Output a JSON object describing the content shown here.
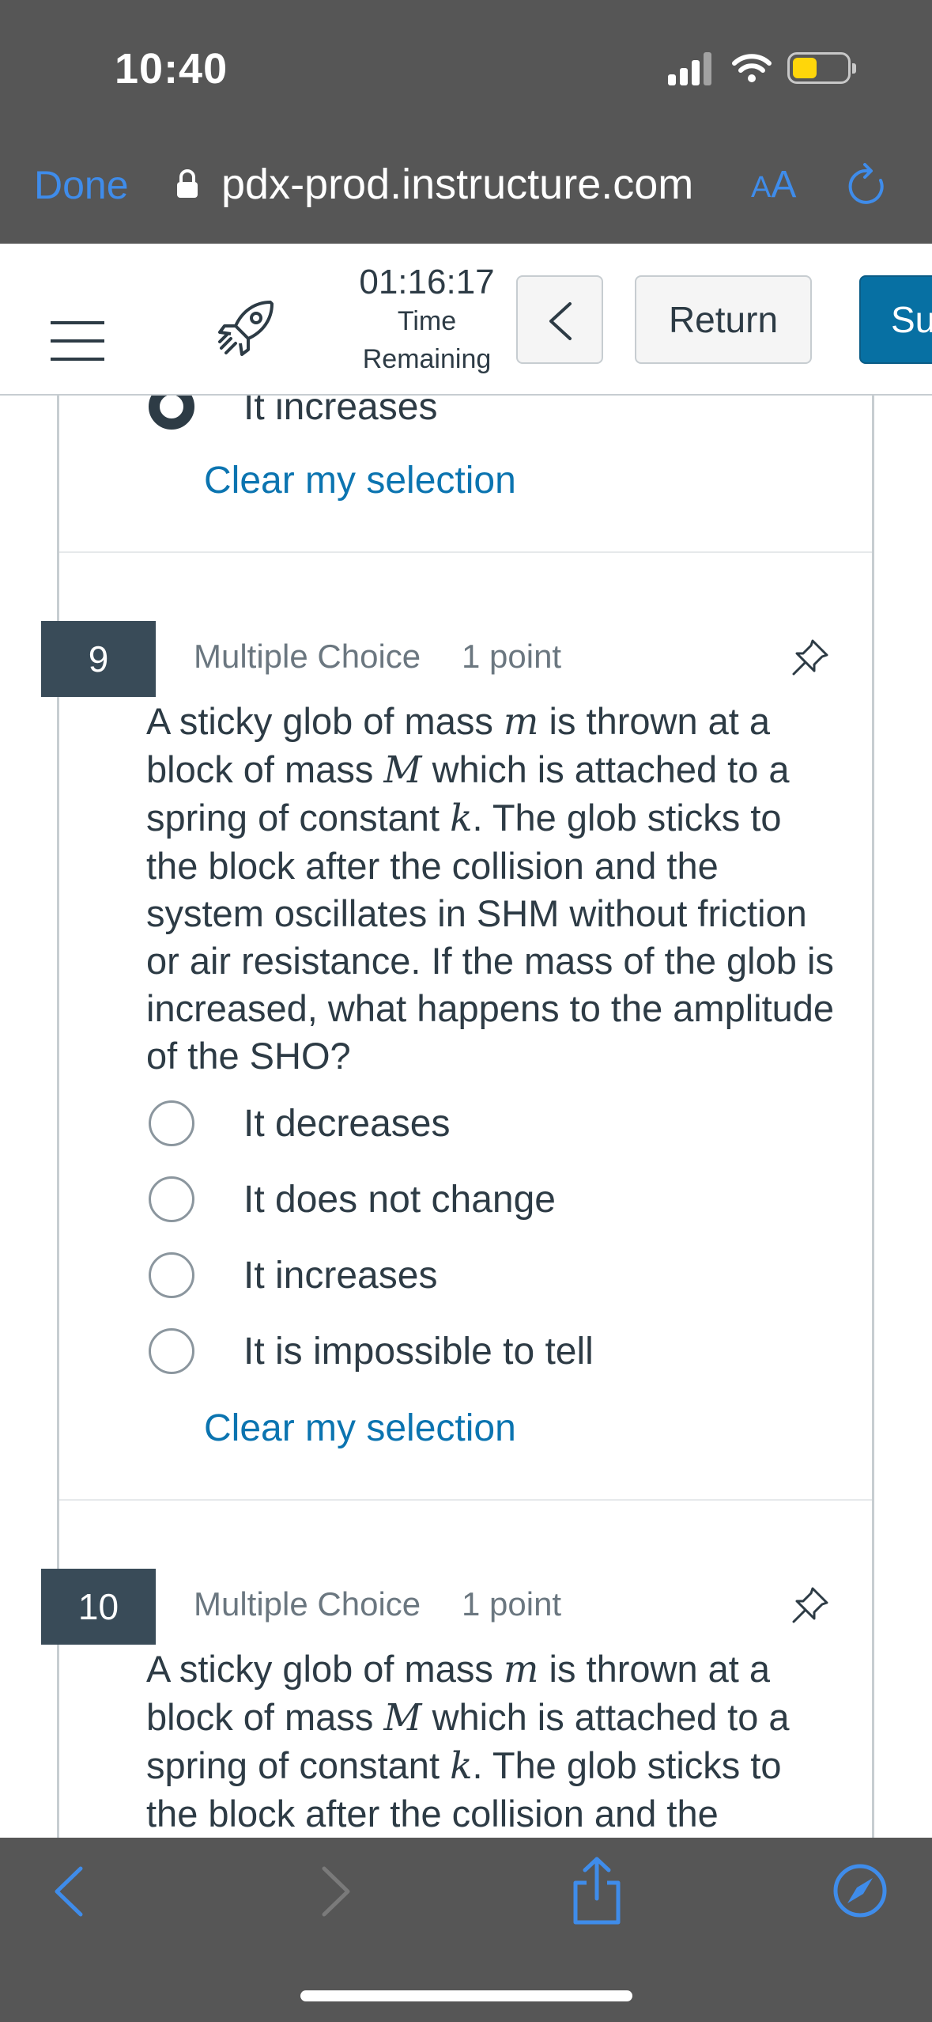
{
  "status_bar": {
    "time": "10:40"
  },
  "browser": {
    "done_label": "Done",
    "url": "pdx-prod.instructure.com",
    "text_size_label_small": "A",
    "text_size_label_large": "A",
    "accent_color": "#3f8cea"
  },
  "quiz_header": {
    "timer_value": "01:16:17",
    "timer_label_line1": "Time",
    "timer_label_line2": "Remaining",
    "return_label": "Return",
    "submit_label": "Su"
  },
  "previous_question": {
    "last_answer": "It increases",
    "clear_label": "Clear my selection"
  },
  "questions": [
    {
      "number": "9",
      "type": "Multiple Choice",
      "points": "1 point",
      "text_parts": [
        "A sticky glob of mass ",
        "m",
        " is thrown at a block of mass ",
        "M",
        " which is attached to a spring of constant ",
        "k",
        ". The glob sticks to the block after the collision and the system oscillates in SHM without friction or air resistance. If the mass of the glob is increased, what happens to the amplitude of the SHO?"
      ],
      "answers": [
        "It decreases",
        "It does not change",
        "It increases",
        "It is impossible to tell"
      ],
      "clear_label": "Clear my selection"
    },
    {
      "number": "10",
      "type": "Multiple Choice",
      "points": "1 point",
      "text_parts": [
        "A sticky glob of mass ",
        "m",
        " is thrown at a block of mass ",
        "M",
        " which is attached to a spring of constant ",
        "k",
        ". The glob sticks to the block after the collision and the system"
      ]
    }
  ],
  "colors": {
    "chrome_gray": "#565656",
    "question_badge": "#394b58",
    "link": "#0b74b0",
    "submit": "#0770a3",
    "battery": "#ffd60a"
  }
}
